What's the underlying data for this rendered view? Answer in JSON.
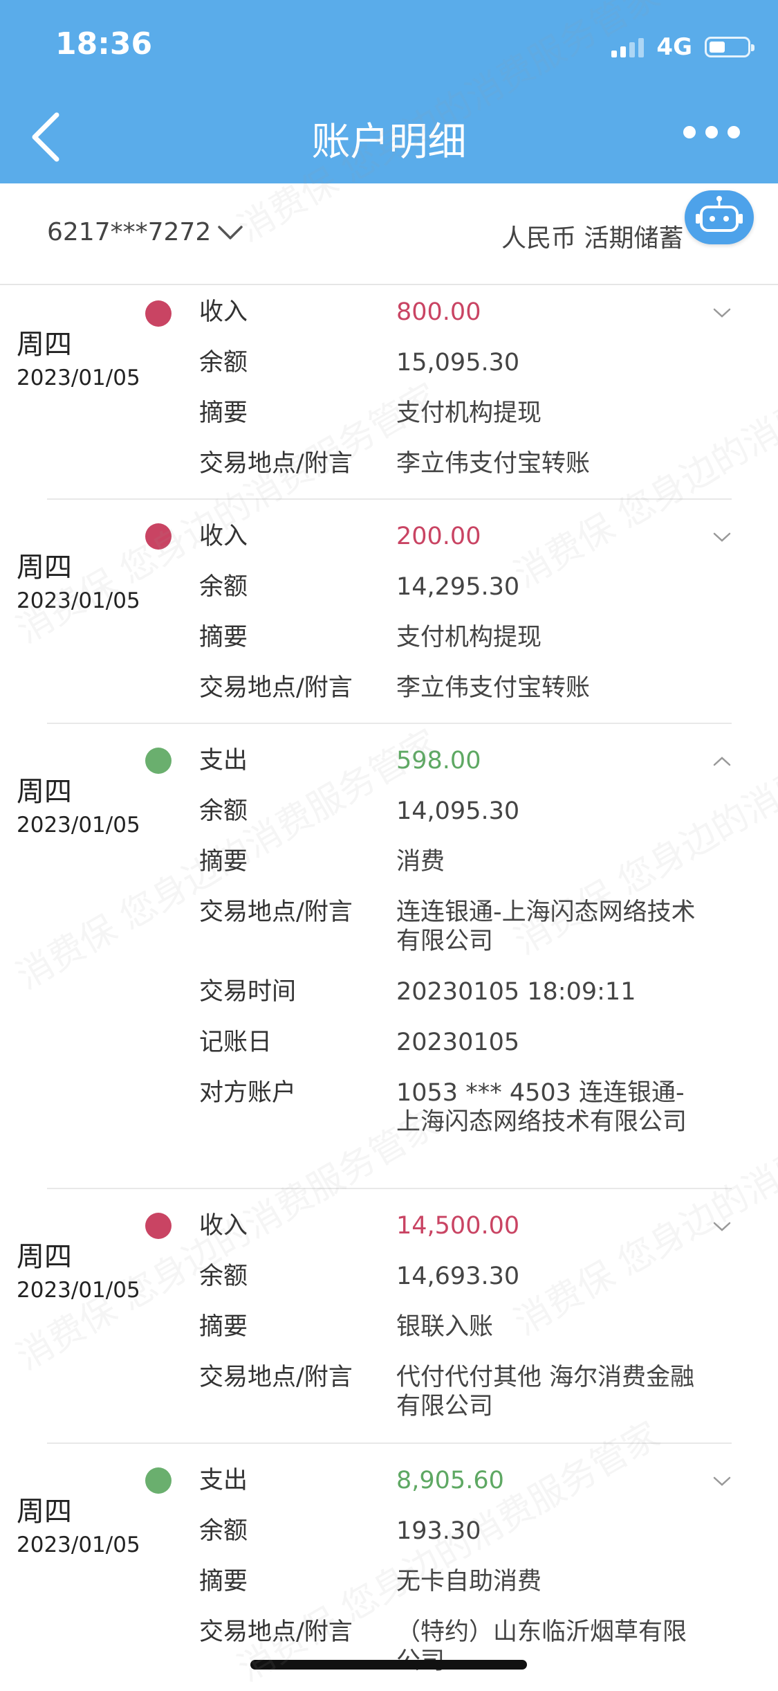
{
  "status_bar": {
    "time": "18:36",
    "network": "4G"
  },
  "header": {
    "title": "账户明细"
  },
  "account": {
    "number": "6217***7272",
    "type": "人民币 活期储蓄"
  },
  "watermark": "消费保 您身边的消费服务管家",
  "transactions": [
    {
      "day": "周四",
      "date": "2023/01/05",
      "direction": "in",
      "fields": [
        {
          "label": "收入",
          "value": "800.00"
        },
        {
          "label": "余额",
          "value": "15,095.30"
        },
        {
          "label": "摘要",
          "value": "支付机构提现"
        },
        {
          "label": "交易地点/附言",
          "value": "李立伟支付宝转账"
        }
      ]
    },
    {
      "day": "周四",
      "date": "2023/01/05",
      "direction": "in",
      "fields": [
        {
          "label": "收入",
          "value": "200.00"
        },
        {
          "label": "余额",
          "value": "14,295.30"
        },
        {
          "label": "摘要",
          "value": "支付机构提现"
        },
        {
          "label": "交易地点/附言",
          "value": "李立伟支付宝转账"
        }
      ]
    },
    {
      "day": "周四",
      "date": "2023/01/05",
      "direction": "out",
      "fields": [
        {
          "label": "支出",
          "value": "598.00"
        },
        {
          "label": "余额",
          "value": "14,095.30"
        },
        {
          "label": "摘要",
          "value": "消费"
        },
        {
          "label": "交易地点/附言",
          "value": "连连银通-上海闪态网络技术有限公司"
        },
        {
          "label": "交易时间",
          "value": "20230105 18:09:11"
        },
        {
          "label": "记账日",
          "value": "20230105"
        },
        {
          "label": "对方账户",
          "value": "1053 *** 4503 连连银通-上海闪态网络技术有限公司"
        }
      ]
    },
    {
      "day": "周四",
      "date": "2023/01/05",
      "direction": "in",
      "fields": [
        {
          "label": "收入",
          "value": "14,500.00"
        },
        {
          "label": "余额",
          "value": "14,693.30"
        },
        {
          "label": "摘要",
          "value": "银联入账"
        },
        {
          "label": "交易地点/附言",
          "value": "代付代付其他 海尔消费金融有限公司"
        }
      ]
    },
    {
      "day": "周四",
      "date": "2023/01/05",
      "direction": "out",
      "fields": [
        {
          "label": "支出",
          "value": "8,905.60"
        },
        {
          "label": "余额",
          "value": "193.30"
        },
        {
          "label": "摘要",
          "value": "无卡自助消费"
        },
        {
          "label": "交易地点/附言",
          "value": "（特约）山东临沂烟草有限公司"
        }
      ]
    }
  ]
}
